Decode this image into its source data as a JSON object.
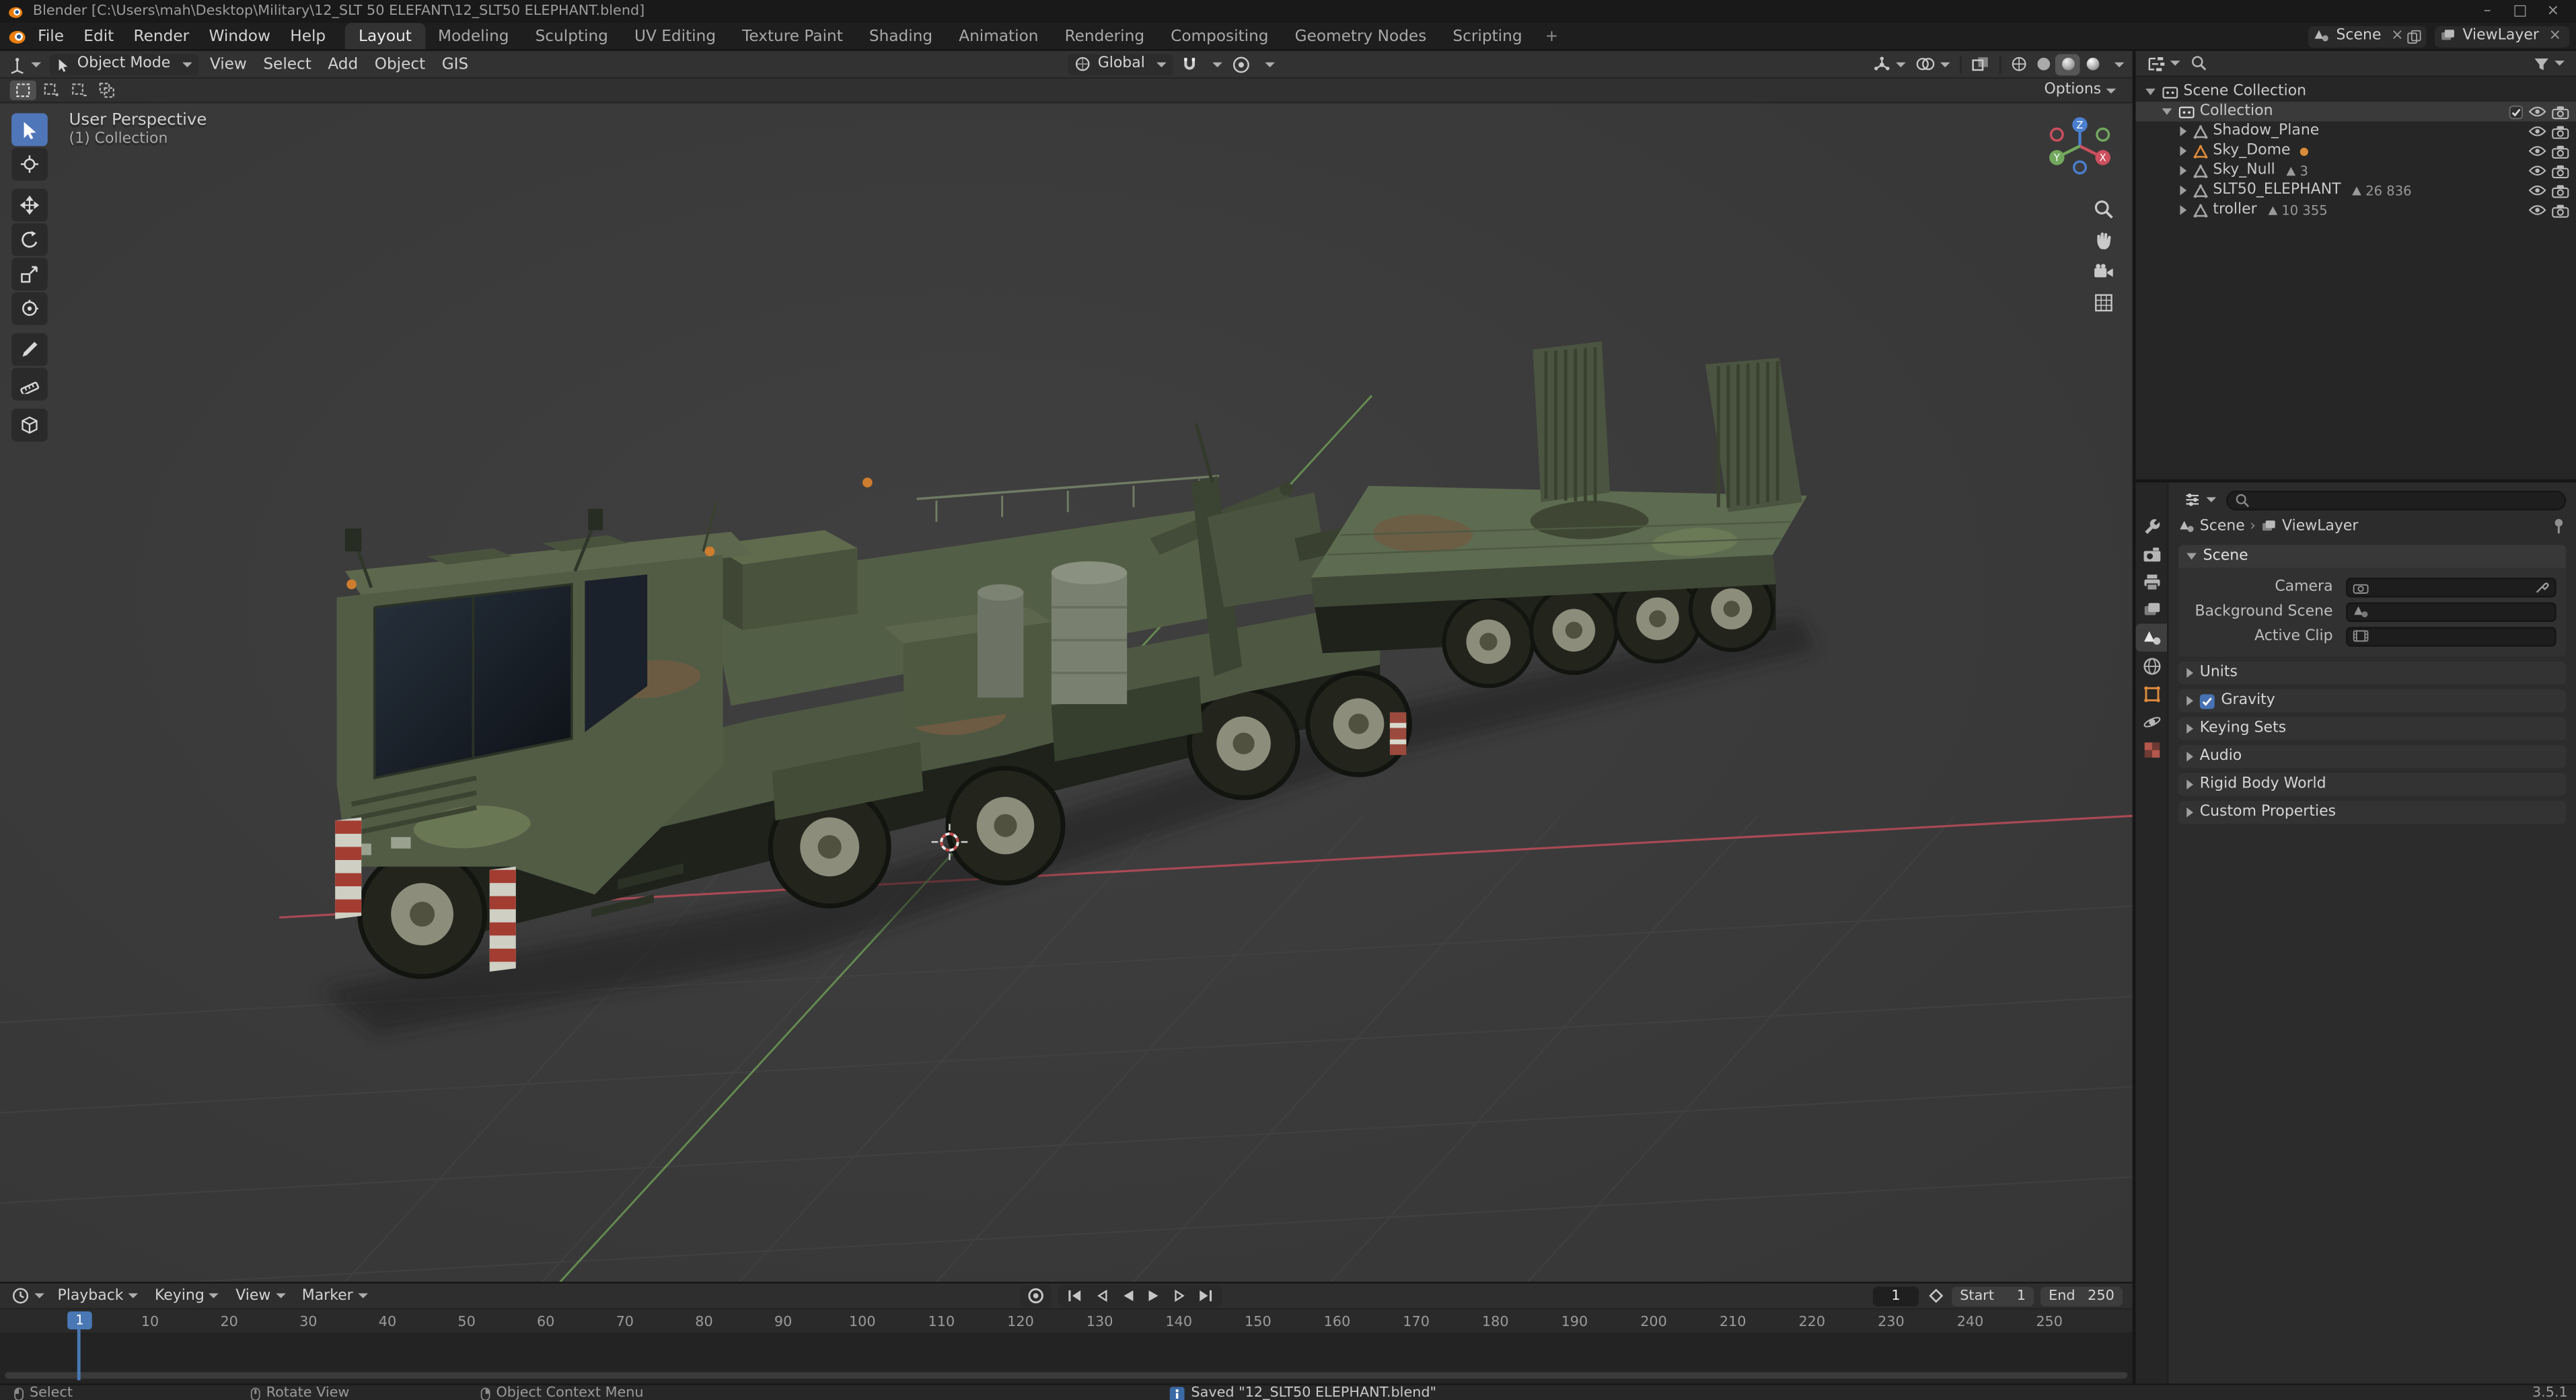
{
  "window": {
    "title": "Blender  [C:\\Users\\mah\\Desktop\\Military\\12_SLT 50 ELEFANT\\12_SLT50 ELEPHANT.blend]"
  },
  "topbar": {
    "menus": [
      "File",
      "Edit",
      "Render",
      "Window",
      "Help"
    ],
    "workspaces": [
      {
        "label": "Layout",
        "active": true
      },
      {
        "label": "Modeling"
      },
      {
        "label": "Sculpting"
      },
      {
        "label": "UV Editing"
      },
      {
        "label": "Texture Paint"
      },
      {
        "label": "Shading"
      },
      {
        "label": "Animation"
      },
      {
        "label": "Rendering"
      },
      {
        "label": "Compositing"
      },
      {
        "label": "Geometry Nodes"
      },
      {
        "label": "Scripting"
      }
    ],
    "add_workspace_label": "+",
    "scene_name": "Scene",
    "view_layer_name": "ViewLayer"
  },
  "viewport": {
    "header": {
      "mode": "Object Mode",
      "menus": [
        "View",
        "Select",
        "Add",
        "Object",
        "GIS"
      ],
      "orientation": "Global",
      "options_label": "Options"
    },
    "overlay": {
      "line1": "User Perspective",
      "line2": "(1) Collection"
    },
    "gizmo_axes": {
      "x": "X",
      "y": "Y",
      "z": "Z"
    }
  },
  "outliner": {
    "root_label": "Scene Collection",
    "collection_label": "Collection",
    "items": [
      {
        "name": "Shadow_Plane",
        "icon_color": "#a5a5a5"
      },
      {
        "name": "Sky_Dome",
        "icon_color": "#de8a3a",
        "dot": true
      },
      {
        "name": "Sky_Null",
        "icon_color": "#a5a5a5",
        "badge": "3"
      },
      {
        "name": "SLT50_ELEPHANT",
        "icon_color": "#a5a5a5",
        "badge": "26 836"
      },
      {
        "name": "troller",
        "icon_color": "#a5a5a5",
        "badge": "10 355"
      }
    ]
  },
  "properties": {
    "breadcrumb": {
      "scene": "Scene",
      "layer": "ViewLayer"
    },
    "scene_panel": {
      "title": "Scene",
      "camera_label": "Camera",
      "background_label": "Background Scene",
      "clip_label": "Active Clip"
    },
    "sections": [
      {
        "label": "Units"
      },
      {
        "label": "Gravity",
        "checkbox": true
      },
      {
        "label": "Keying Sets"
      },
      {
        "label": "Audio"
      },
      {
        "label": "Rigid Body World"
      },
      {
        "label": "Custom Properties"
      }
    ]
  },
  "timeline": {
    "menus": [
      "Playback",
      "Keying",
      "View",
      "Marker"
    ],
    "playhead_frame": "1",
    "frame_field_value": "1",
    "start_label": "Start",
    "start_value": "1",
    "end_label": "End",
    "end_value": "250",
    "ticks": [
      10,
      20,
      30,
      40,
      50,
      60,
      70,
      80,
      90,
      100,
      110,
      120,
      130,
      140,
      150,
      160,
      170,
      180,
      190,
      200,
      210,
      220,
      230,
      240,
      250
    ]
  },
  "statusbar": {
    "hints": [
      "Select",
      "Rotate View",
      "Object Context Menu"
    ],
    "message": "Saved \"12_SLT50 ELEPHANT.blend\"",
    "version": "3.5.1"
  },
  "icons": {
    "blender-logo": "orange-disc",
    "search": "magnifier",
    "filter": "funnel",
    "eye": "visibility",
    "camera": "render-visibility",
    "magnet": "snapping",
    "checkbox": "check",
    "pin": "pushpin",
    "clock": "timeline-editor",
    "info": "blue-info-square",
    "mouse-left": "lmb",
    "mouse-middle": "mmb",
    "mouse-right": "rmb"
  }
}
